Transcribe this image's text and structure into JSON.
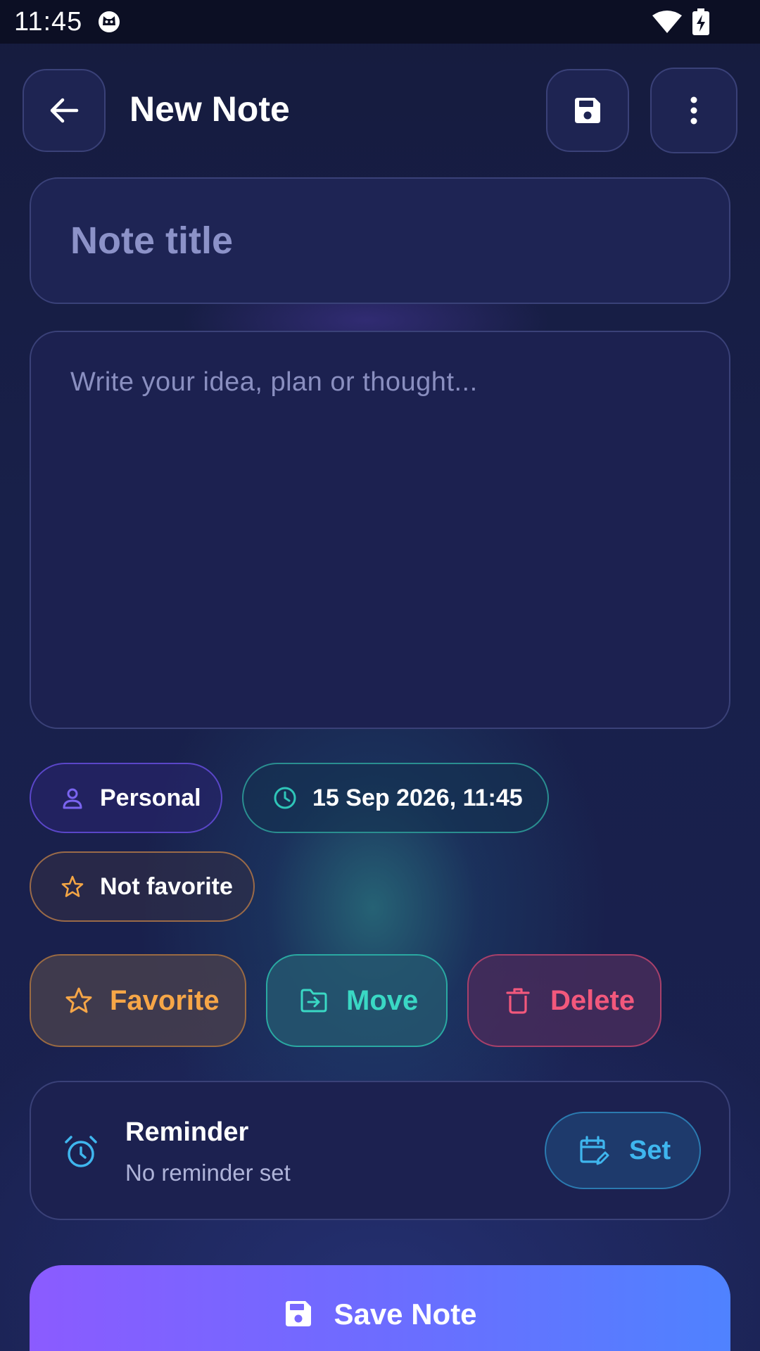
{
  "status_bar": {
    "time": "11:45"
  },
  "header": {
    "title": "New Note"
  },
  "title_field": {
    "placeholder": "Note title",
    "value": ""
  },
  "body_field": {
    "placeholder": "Write your idea, plan or thought...",
    "value": ""
  },
  "chips": {
    "category": "Personal",
    "date": "15 Sep 2026, 11:45",
    "favorite_state": "Not favorite"
  },
  "actions": {
    "favorite": "Favorite",
    "move": "Move",
    "delete": "Delete"
  },
  "reminder": {
    "title": "Reminder",
    "subtitle": "No reminder set",
    "button": "Set"
  },
  "save_button": "Save Note",
  "colors": {
    "accent_purple": "#8b5bff",
    "accent_blue": "#4f82ff",
    "favorite": "#f6a647",
    "move": "#3ad8c4",
    "delete": "#f2587c",
    "reminder": "#3fb6ee"
  }
}
